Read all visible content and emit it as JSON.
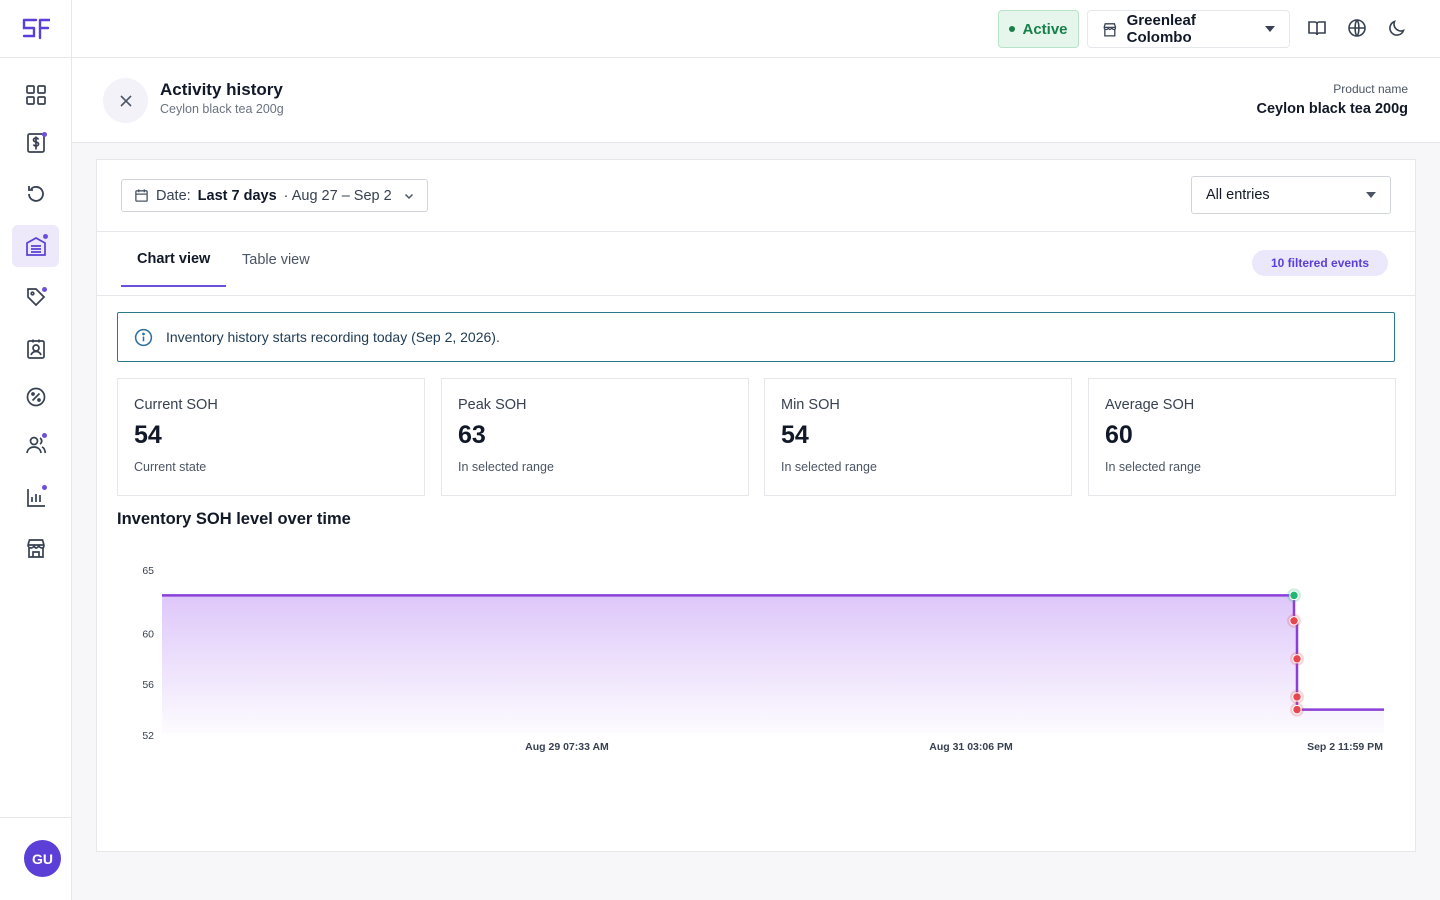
{
  "sidebar": {
    "logo": "sf-logo",
    "items": [
      {
        "icon": "dashboard-icon",
        "active": false,
        "dot": false
      },
      {
        "icon": "sales-icon",
        "active": false,
        "dot": true
      },
      {
        "icon": "history-icon",
        "active": false,
        "dot": false
      },
      {
        "icon": "inventory-icon",
        "active": true,
        "dot": true
      },
      {
        "icon": "tag-icon",
        "active": false,
        "dot": true
      },
      {
        "icon": "contact-icon",
        "active": false,
        "dot": false
      },
      {
        "icon": "discount-icon",
        "active": false,
        "dot": false
      },
      {
        "icon": "users-icon",
        "active": false,
        "dot": true
      },
      {
        "icon": "reports-icon",
        "active": false,
        "dot": true
      },
      {
        "icon": "store-icon",
        "active": false,
        "dot": false
      }
    ],
    "avatar_initials": "GU"
  },
  "topbar": {
    "status_label": "Active",
    "store_name": "Greenleaf Colombo",
    "icons": [
      "book-icon",
      "globe-icon",
      "moon-icon"
    ]
  },
  "header": {
    "title": "Activity history",
    "subtitle": "Ceylon black tea 200g",
    "product_label": "Product name",
    "product_value": "Ceylon black tea 200g"
  },
  "filters": {
    "date_prefix": "Date:",
    "date_range_name": "Last 7 days",
    "date_range_dates": "· Aug 27 – Sep 2",
    "entries_selected": "All entries"
  },
  "tabs": {
    "chart": "Chart view",
    "table": "Table view",
    "events_badge": "10 filtered events"
  },
  "banner": {
    "text": "Inventory history starts recording today (Sep 2, 2026)."
  },
  "stats": [
    {
      "label": "Current SOH",
      "value": "54",
      "note": "Current state"
    },
    {
      "label": "Peak SOH",
      "value": "63",
      "note": "In selected range"
    },
    {
      "label": "Min SOH",
      "value": "54",
      "note": "In selected range"
    },
    {
      "label": "Average SOH",
      "value": "60",
      "note": "In selected range"
    }
  ],
  "chart_data": {
    "type": "area",
    "title": "Inventory SOH level over time",
    "xlabel": "",
    "ylabel": "",
    "ylim": [
      52,
      65
    ],
    "y_ticks": [
      "65",
      "60",
      "56",
      "52"
    ],
    "x_ticks": [
      "Aug 29 07:33 AM",
      "Aug 31 03:06 PM",
      "Sep 2 11:59 PM"
    ],
    "line_color": "#8b3fd8",
    "series": [
      {
        "values": [
          {
            "x": "Aug 27 12:00 AM",
            "y": 63
          },
          {
            "x": "Sep 2 (event 1)",
            "y": 63
          },
          {
            "x": "Sep 2 (event 2)",
            "y": 61
          },
          {
            "x": "Sep 2 (event 3)",
            "y": 58
          },
          {
            "x": "Sep 2 (event 4)",
            "y": 55
          },
          {
            "x": "Sep 2 (event 5)",
            "y": 54
          },
          {
            "x": "Sep 2 11:59 PM",
            "y": 54
          }
        ]
      }
    ],
    "event_markers": [
      {
        "y": 63,
        "color": "#22b573"
      },
      {
        "y": 61,
        "color": "#e5484d"
      },
      {
        "y": 58,
        "color": "#e5484d"
      },
      {
        "y": 55,
        "color": "#e5484d"
      },
      {
        "y": 54,
        "color": "#e5484d"
      }
    ]
  }
}
